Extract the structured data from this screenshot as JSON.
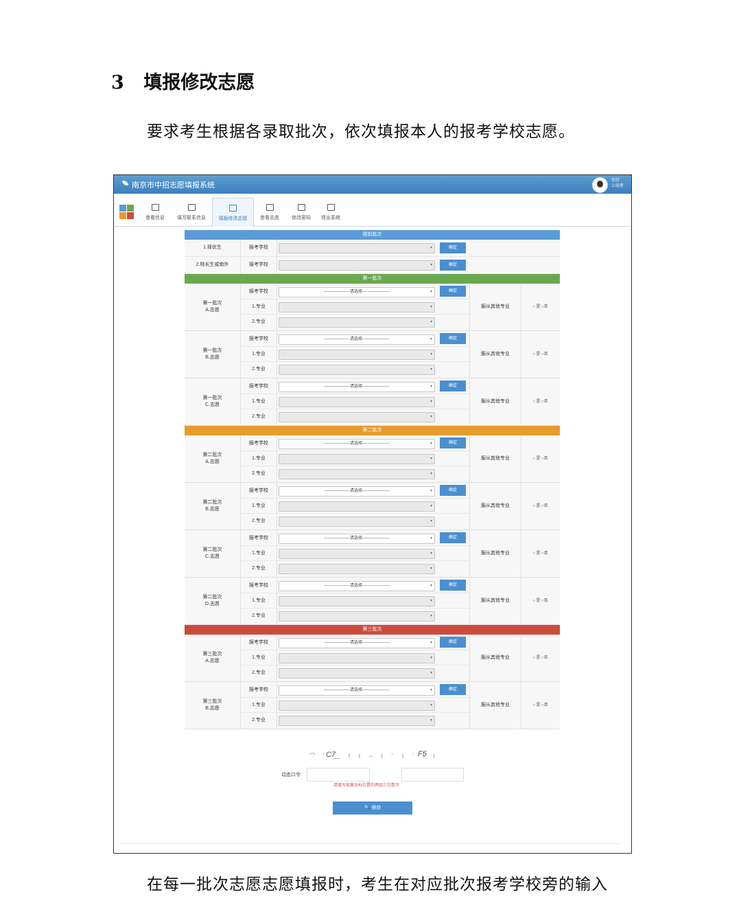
{
  "doc": {
    "section_number": "3",
    "section_title": "填报修改志愿",
    "paragraph_1": "要求考生根据各录取批次，依次填报本人的报考学校志愿。",
    "paragraph_2": "在每一批次志愿志愿填报时，考生在对应批次报考学校旁的输入"
  },
  "app": {
    "title": "南京市中招志愿填报系统",
    "user_line1": "你好",
    "user_line2": "上线者",
    "tabs": [
      {
        "label": "查看信息",
        "icon": "dashboard-icon"
      },
      {
        "label": "填写联系信息",
        "icon": "monitor-icon"
      },
      {
        "label": "填报修改志愿",
        "icon": "list-icon"
      },
      {
        "label": "查看志愿",
        "icon": "edit-icon"
      },
      {
        "label": "修改密码",
        "icon": "keyboard-icon"
      },
      {
        "label": "退出系统",
        "icon": "calendar-icon"
      }
    ],
    "active_tab": "填报修改志愿",
    "colors": {
      "header": "#3a7fbe",
      "batch0": "#5b9bd5",
      "batch1": "#6aa84f",
      "batch2": "#e69b2e",
      "batch3": "#cc4b3c"
    }
  },
  "form": {
    "early_title": "提前批次",
    "early_rows": [
      {
        "label": "1.择优生",
        "field": "报考学校",
        "button": "确定"
      },
      {
        "label": "2.特长生或南外",
        "field": "报考学校",
        "button": "确定"
      }
    ],
    "school_label": "报考学校",
    "major1_label": "1.专业",
    "major2_label": "2.专业",
    "select_placeholder": "-------------------请选择--------------------",
    "confirm_label": "确定",
    "obey_label": "服从其他专业",
    "radio_yes": "是",
    "radio_no": "否",
    "batches": [
      {
        "title": "第一批次",
        "groups": [
          {
            "label1": "第一批次",
            "label2": "A.志愿"
          },
          {
            "label1": "第一批次",
            "label2": "B.志愿"
          },
          {
            "label1": "第一批次",
            "label2": "C.志愿"
          }
        ]
      },
      {
        "title": "第二批次",
        "groups": [
          {
            "label1": "第二批次",
            "label2": "A.志愿"
          },
          {
            "label1": "第二批次",
            "label2": "B.志愿"
          },
          {
            "label1": "第二批次",
            "label2": "C.志愿"
          },
          {
            "label1": "第二批次",
            "label2": "D.志愿"
          }
        ]
      },
      {
        "title": "第三批次",
        "groups": [
          {
            "label1": "第三批次",
            "label2": "A.志愿"
          },
          {
            "label1": "第三批次",
            "label2": "B.志愿"
          }
        ]
      }
    ],
    "captcha_chars": [
      "C7",
      "F5"
    ],
    "dynamic_code_label": "动态口令:",
    "hint": "请填写如果坐标位置的两组三位数字",
    "save_label": "保存"
  }
}
